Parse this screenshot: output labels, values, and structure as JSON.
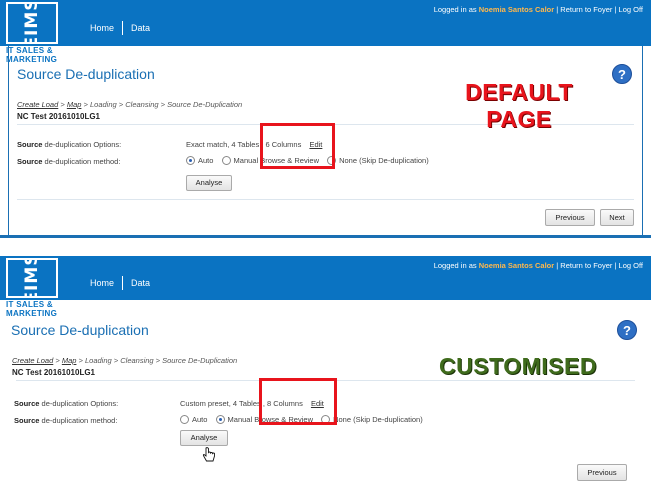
{
  "panels": [
    {
      "nav": {
        "home": "Home",
        "data": "Data"
      },
      "logo": {
        "mark": "EIMS",
        "sub1": "IT SALES &",
        "sub2": "MARKETING"
      },
      "user": {
        "prefix": "Logged in as",
        "name": "Noemia Santos Calor",
        "return": "Return to Foyer",
        "logoff": "Log Off"
      },
      "title": "Source De-duplication",
      "breadcrumb": {
        "first": "Create Load",
        "second": "Map",
        "rest": "> Loading > Cleansing > Source De-Duplication"
      },
      "load_name": "NC Test 20161010LG1",
      "options_label_bold": "Source",
      "options_label_rest": "de-duplication Options:",
      "options_value": "Exact match, 4 Tables , 6 Columns",
      "edit_label": "Edit",
      "method_label_bold": "Source",
      "method_label_rest": "de-duplication method:",
      "methods": [
        "Auto",
        "Manual Browse & Review",
        "None (Skip De-duplication)"
      ],
      "selected_method": 0,
      "analyse_label": "Analyse",
      "previous_label": "Previous",
      "next_label": "Next",
      "annotation_line1": "DEFAULT",
      "annotation_line2": "PAGE",
      "highlight_color": "#e8141c"
    },
    {
      "nav": {
        "home": "Home",
        "data": "Data"
      },
      "logo": {
        "mark": "EIMS",
        "sub1": "IT SALES &",
        "sub2": "MARKETING"
      },
      "user": {
        "prefix": "Logged in as",
        "name": "Noemia Santos Calor",
        "return": "Return to Foyer",
        "logoff": "Log Off"
      },
      "title": "Source De-duplication",
      "breadcrumb": {
        "first": "Create Load",
        "second": "Map",
        "rest": "> Loading > Cleansing > Source De-Duplication"
      },
      "load_name": "NC Test 20161010LG1",
      "options_label_bold": "Source",
      "options_label_rest": "de-duplication Options:",
      "options_value": "Custom preset, 4 Tables , 8 Columns",
      "edit_label": "Edit",
      "method_label_bold": "Source",
      "method_label_rest": "de-duplication method:",
      "methods": [
        "Auto",
        "Manual Browse & Review",
        "None (Skip De-duplication)"
      ],
      "selected_method": 1,
      "analyse_label": "Analyse",
      "previous_label": "Previous",
      "annotation": "CUSTOMISED",
      "highlight_color": "#e8141c"
    }
  ],
  "colors": {
    "topbar": "#0a73c2",
    "title": "#1a6fb3",
    "username": "#ffb84d",
    "annot_default": "#e8141c",
    "annot_custom": "#3f6b1c"
  }
}
